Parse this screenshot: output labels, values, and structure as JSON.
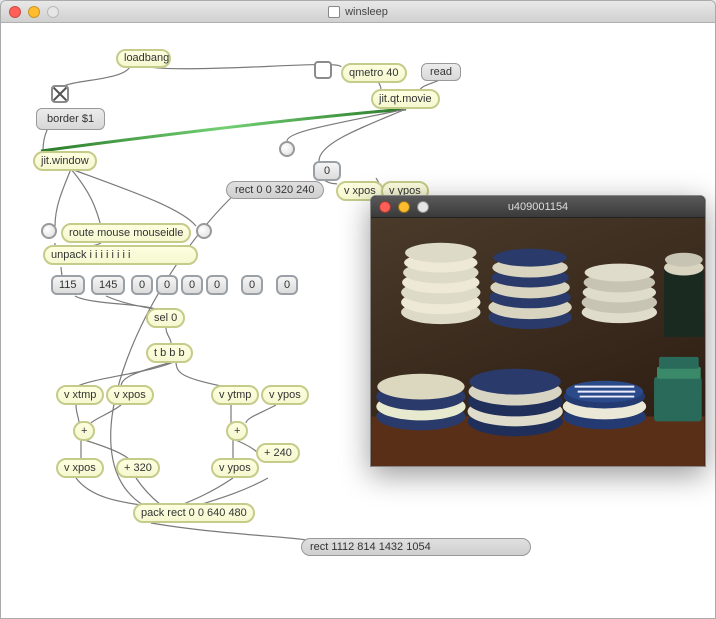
{
  "window": {
    "title": "winsleep"
  },
  "objects": {
    "loadbang": "loadbang",
    "qmetro": "qmetro 40",
    "read": "read",
    "jitqtmovie": "jit.qt.movie",
    "border": "border $1",
    "jitwindow": "jit.window",
    "route": "route mouse mouseidle",
    "unpack": "unpack i i i i i i i i",
    "sel": "sel 0",
    "tbbb": "t b b b",
    "v_xtmp": "v xtmp",
    "v_xpos1": "v xpos",
    "v_ytmp": "v ytmp",
    "v_ypos1": "v ypos",
    "v_xpos2": "v xpos",
    "v_ypos2": "v ypos",
    "v_xpos3": "v xpos",
    "v_ypos3": "v ypos",
    "plus1": "+",
    "plus2": "+",
    "plus320": "+ 320",
    "plus240": "+ 240",
    "pack": "pack rect 0 0 640 480",
    "rect_small": "rect 0 0 320 240",
    "rect_out": "rect 1112 814 1432 1054"
  },
  "numbers": {
    "n0_a": "0",
    "n1": "115",
    "n2": "145",
    "n3": "0",
    "n4": "0",
    "n5": "0",
    "n6": "0",
    "n7": "0",
    "n8": "0"
  },
  "video_window": {
    "title": "u409001154"
  }
}
